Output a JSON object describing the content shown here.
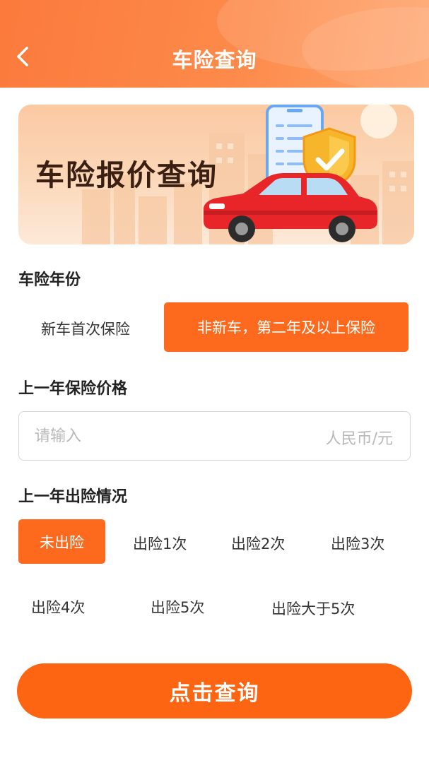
{
  "header": {
    "title": "车险查询",
    "back_icon": "chevron-left-icon"
  },
  "banner": {
    "text": "车险报价查询"
  },
  "insurance_year": {
    "label": "车险年份",
    "options": [
      "新车首次保险",
      "非新车，第二年及以上保险"
    ],
    "selected": "非新车，第二年及以上保险"
  },
  "last_price": {
    "label": "上一年保险价格",
    "placeholder": "请输入",
    "value": "",
    "unit": "人民币/元"
  },
  "claims": {
    "label": "上一年出险情况",
    "options": [
      "未出险",
      "出险1次",
      "出险2次",
      "出险3次",
      "出险4次",
      "出险5次",
      "出险大于5次"
    ],
    "selected": "未出险"
  },
  "submit": {
    "label": "点击查询"
  },
  "colors": {
    "accent": "#fd6512",
    "header_start": "#fb7a3c",
    "header_end": "#fea36a"
  }
}
